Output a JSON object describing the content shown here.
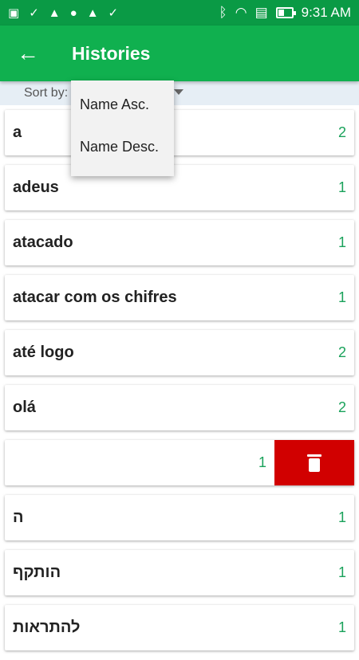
{
  "statusbar": {
    "time": "9:31 AM",
    "left_icons": [
      "image-icon",
      "check-icon",
      "warning-icon",
      "alert-icon",
      "warning-icon",
      "check-icon"
    ]
  },
  "appbar": {
    "title": "Histories",
    "back_icon": "←"
  },
  "sort": {
    "label": "Sort by:",
    "options": [
      "Name Asc.",
      "Name Desc."
    ]
  },
  "rows": [
    {
      "word": "a",
      "count": "2"
    },
    {
      "word": "adeus",
      "count": "1"
    },
    {
      "word": "atacado",
      "count": "1"
    },
    {
      "word": "atacar com os chifres",
      "count": "1"
    },
    {
      "word": "até logo",
      "count": "2"
    },
    {
      "word": "olá",
      "count": "2"
    },
    {
      "word": "",
      "count": "1"
    },
    {
      "word": "ה",
      "count": "1"
    },
    {
      "word": "הותקף",
      "count": "1"
    },
    {
      "word": "להתראות",
      "count": "1"
    }
  ],
  "colors": {
    "statusbar": "#0a9a45",
    "appbar": "#10b04f",
    "count": "#1aa25b",
    "delete": "#d10000"
  }
}
